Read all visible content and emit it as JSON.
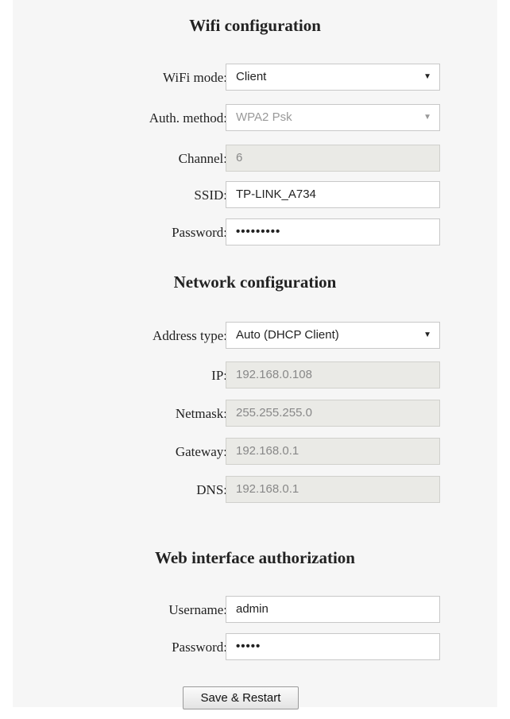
{
  "wifi": {
    "title": "Wifi configuration",
    "mode_label": "WiFi mode:",
    "mode_value": "Client",
    "auth_label": "Auth. method:",
    "auth_value": "WPA2 Psk",
    "channel_label": "Channel:",
    "channel_value": "6",
    "ssid_label": "SSID:",
    "ssid_value": "TP-LINK_A734",
    "password_label": "Password:",
    "password_value": "•••••••••"
  },
  "network": {
    "title": "Network configuration",
    "address_type_label": "Address type:",
    "address_type_value": "Auto (DHCP Client)",
    "ip_label": "IP:",
    "ip_value": "192.168.0.108",
    "netmask_label": "Netmask:",
    "netmask_value": "255.255.255.0",
    "gateway_label": "Gateway:",
    "gateway_value": "192.168.0.1",
    "dns_label": "DNS:",
    "dns_value": "192.168.0.1"
  },
  "web_auth": {
    "title": "Web interface authorization",
    "username_label": "Username:",
    "username_value": "admin",
    "password_label": "Password:",
    "password_value": "•••••"
  },
  "actions": {
    "save_label": "Save & Restart"
  },
  "icons": {
    "dropdown": "chevron-down-icon"
  }
}
